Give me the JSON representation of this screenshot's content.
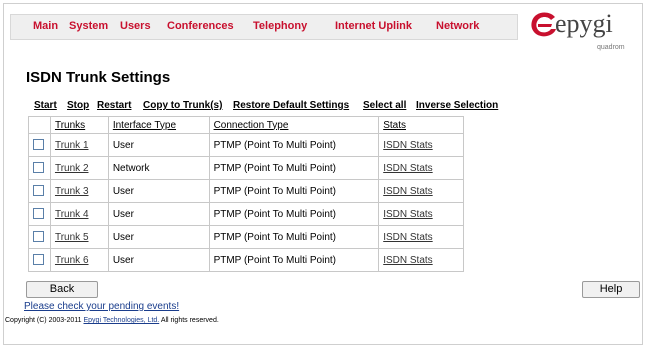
{
  "nav": {
    "main": "Main",
    "system": "System",
    "users": "Users",
    "conferences": "Conferences",
    "telephony": "Telephony",
    "internet_uplink": "Internet Uplink",
    "network": "Network"
  },
  "logo": {
    "word": "epygi",
    "sub": "quadrom",
    "accent": "#c8102e"
  },
  "page": {
    "title": "ISDN Trunk Settings"
  },
  "actions": {
    "start": "Start",
    "stop": "Stop",
    "restart": "Restart",
    "copy": "Copy to Trunk(s)",
    "restore": "Restore Default Settings",
    "select_all": "Select all",
    "inverse": "Inverse Selection"
  },
  "table": {
    "headers": {
      "trunks": "Trunks",
      "interface_type": "Interface Type",
      "connection_type": "Connection Type",
      "stats": "Stats"
    },
    "rows": [
      {
        "trunk": "Trunk 1",
        "interface": "User",
        "connection": "PTMP (Point To Multi Point)",
        "stats": "ISDN Stats"
      },
      {
        "trunk": "Trunk 2",
        "interface": "Network",
        "connection": "PTMP (Point To Multi Point)",
        "stats": "ISDN Stats"
      },
      {
        "trunk": "Trunk 3",
        "interface": "User",
        "connection": "PTMP (Point To Multi Point)",
        "stats": "ISDN Stats"
      },
      {
        "trunk": "Trunk 4",
        "interface": "User",
        "connection": "PTMP (Point To Multi Point)",
        "stats": "ISDN Stats"
      },
      {
        "trunk": "Trunk 5",
        "interface": "User",
        "connection": "PTMP (Point To Multi Point)",
        "stats": "ISDN Stats"
      },
      {
        "trunk": "Trunk 6",
        "interface": "User",
        "connection": "PTMP (Point To Multi Point)",
        "stats": "ISDN Stats"
      }
    ]
  },
  "buttons": {
    "back": "Back",
    "help": "Help"
  },
  "footer": {
    "pending": "Please check your pending events!",
    "copyright_prefix": "Copyright (C) 2003-2011",
    "company": "Epygi Technologies, Ltd.",
    "rights": "All rights reserved."
  }
}
